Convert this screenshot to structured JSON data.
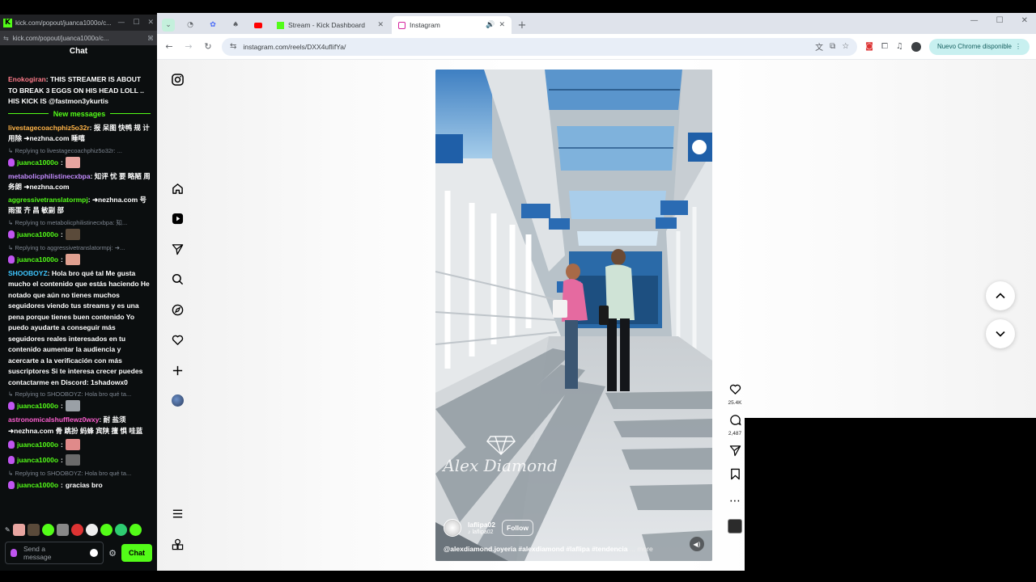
{
  "chat_window": {
    "title": "kick.com/popout/juanca1000o/c...",
    "url": "kick.com/popout/juanca1000o/c...",
    "header": "Chat",
    "top_message": {
      "user": "Enokogiran",
      "user_color": "#ff7c8a",
      "text": "THIS STREAMER IS ABOUT TO BREAK 3 EGGS ON HIS HEAD LOLL .. HIS KICK IS @fastmon3ykurtis"
    },
    "new_messages_label": "New messages",
    "messages": [
      {
        "type": "msg",
        "user": "livestagecoachphiz5o32r",
        "color": "#ffb347",
        "text": "报 呆图 快鸭 规 计 用除 ➜nezhna.com 睡嘻"
      },
      {
        "type": "reply",
        "text": "↳ Replying to livestagecoachphiz5o32r: ..."
      },
      {
        "type": "mod",
        "user": "juanca1000o",
        "thumb": "#e8a5a0"
      },
      {
        "type": "msg",
        "user": "metabolicphilistinecxbpa",
        "color": "#c48cff",
        "text": "知评 忧 要 略陋 周 务朗 ➜nezhna.com"
      },
      {
        "type": "msg",
        "user": "aggressivetranslatormpj",
        "color": "#53fc18",
        "text": "➜nezhna.com 号 雨蛋 齐 昌 敏副 部"
      },
      {
        "type": "reply",
        "text": "↳ Replying to metabolicphilistinecxbpa: 知..."
      },
      {
        "type": "mod",
        "user": "juanca1000o",
        "thumb": "#5a4a3a"
      },
      {
        "type": "reply",
        "text": "↳ Replying to aggressivetranslatormpj: ➜..."
      },
      {
        "type": "mod",
        "user": "juanca1000o",
        "thumb": "#e0a090"
      },
      {
        "type": "msg",
        "user": "SHOOBOYZ",
        "color": "#3ec6ff",
        "text": "Hola bro qué tal Me gusta mucho el contenido que estás haciendo He notado que aún no tienes muchos seguidores viendo tus streams y es una pena porque tienes buen contenido Yo puedo ayudarte a conseguir más seguidores reales interesados en tu contenido aumentar la audiencia y acercarte a la verificación con más suscriptores Si te interesa crecer puedes contactarme en Discord: 1shadowx0"
      },
      {
        "type": "reply",
        "text": "↳ Replying to SHOOBOYZ: Hola bro qué ta..."
      },
      {
        "type": "mod",
        "user": "juanca1000o",
        "thumb": "#9aa0a6"
      },
      {
        "type": "msg",
        "user": "astronomicalshufflewz0wxy",
        "color": "#ff5fd1",
        "text": "耐 盐须 ➜nezhna.com 骨 跳扮 蚂蜂 宾陕 擅 惧 哇蓝"
      },
      {
        "type": "mod",
        "user": "juanca1000o",
        "thumb": "#e08a8a"
      },
      {
        "type": "mod",
        "user": "juanca1000o",
        "thumb": "#6a6a6a"
      },
      {
        "type": "reply",
        "text": "↳ Replying to SHOOBOYZ: Hola bro qué ta..."
      },
      {
        "type": "mod",
        "user": "juanca1000o",
        "text": "gracias bro"
      }
    ],
    "input_placeholder": "Send a message",
    "chat_button": "Chat"
  },
  "browser": {
    "tabs": [
      {
        "label": "Stream - Kick Dashboard",
        "active": false
      },
      {
        "label": "Instagram",
        "active": true
      }
    ],
    "url": "instagram.com/reels/DXX4ufIifYa/",
    "update_label": "Nuevo Chrome disponible"
  },
  "reel": {
    "username": "laflipa02",
    "sub_label": "laflipa02",
    "follow_label": "Follow",
    "caption": "@alexdiamond.joyeria #alexdiamond #laflipa #tendencia",
    "more_label": "... more",
    "watermark": "Alex Diamond",
    "likes": "25.4K",
    "comments": "2,487"
  },
  "icons": {
    "nav": [
      "instagram-icon",
      "home-icon",
      "reels-icon",
      "send-icon",
      "search-icon",
      "explore-icon",
      "heart-icon",
      "plus-icon",
      "profile-avatar",
      "menu-icon",
      "also-from-meta-icon"
    ],
    "actions": [
      "like-icon",
      "comment-icon",
      "share-icon",
      "save-icon",
      "more-icon"
    ]
  },
  "colors": {
    "kick_green": "#53fc18",
    "mic_purple": "#c055f0"
  }
}
